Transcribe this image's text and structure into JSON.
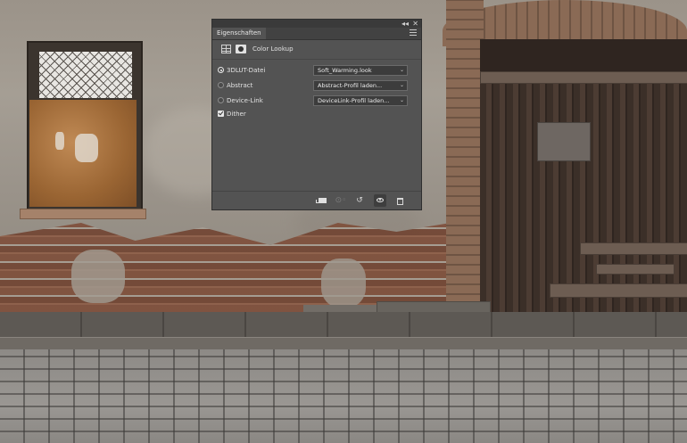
{
  "panel": {
    "tab_label": "Eigenschaften",
    "collapse_icon": "double-chevron-icon",
    "close_icon": "close-icon",
    "menu_icon": "panel-menu-icon",
    "header": {
      "title": "Color Lookup",
      "icons": [
        "adjustment-grid-icon",
        "layer-mask-icon"
      ]
    },
    "options": [
      {
        "label": "3DLUT-Datei",
        "selected": true,
        "value": "Soft_Warming.look"
      },
      {
        "label": "Abstract",
        "selected": false,
        "value": "Abstract-Profil laden..."
      },
      {
        "label": "Device-Link",
        "selected": false,
        "value": "DeviceLink-Profil laden..."
      }
    ],
    "dither": {
      "label": "Dither",
      "checked": true
    },
    "bottom_icons": [
      "clip-to-layer-icon",
      "view-previous-state-icon",
      "reset-icon",
      "visibility-eye-icon",
      "trash-icon"
    ]
  },
  "titlebar": {
    "collapse_glyph": "◂◂",
    "close_glyph": "✕"
  },
  "dropdown_arrow": "⌄",
  "bottom_glyphs": {
    "previous": "⊙◦",
    "reset": "↺"
  }
}
